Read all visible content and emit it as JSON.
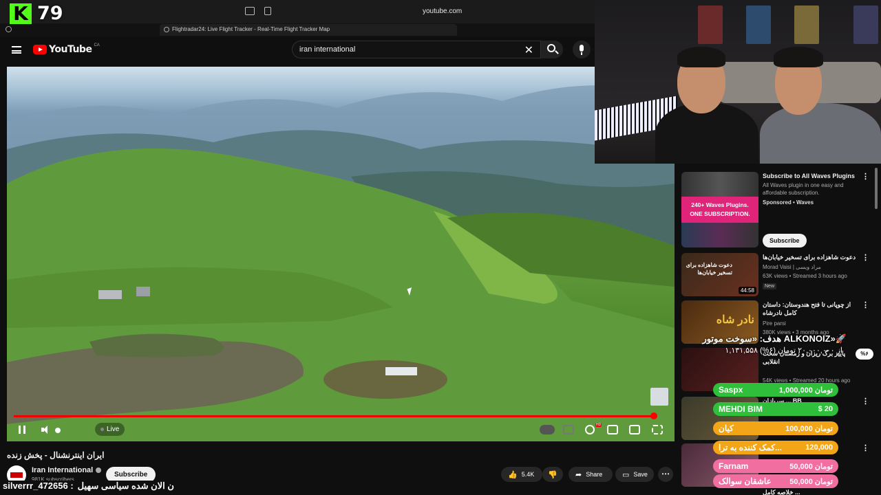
{
  "stream": {
    "viewer_count": "79",
    "platform_logo": "K"
  },
  "browser": {
    "url": "youtube.com",
    "tab_title": "Flightradar24: Live Flight Tracker - Real-Time Flight Tracker Map"
  },
  "youtube": {
    "logo_text": "YouTube",
    "region": "CA",
    "search_value": "iran international",
    "search_clear": "✕"
  },
  "player": {
    "live_label": "Live",
    "progress_fraction": 0.99
  },
  "video": {
    "title": "ایران اینترنشنال - پخش زنده",
    "channel_name": "Iran International",
    "subscribers": "981K subscribers",
    "subscribe_label": "Subscribe",
    "likes": "5.4K",
    "share_label": "Share",
    "save_label": "Save"
  },
  "chat": {
    "user": "silverrr_472656 :",
    "message": "ن الان شده سیاسی سهیل"
  },
  "sidebar": {
    "items": [
      {
        "title": "Subscribe to All Waves Plugins",
        "meta1": "All Waves plugin in one easy and affordable subscription.",
        "meta2": "Sponsored • Waves",
        "thumb_line1": "240+ Waves Plugins.",
        "thumb_line2": "ONE SUBSCRIPTION.",
        "button": "Subscribe"
      },
      {
        "title": "دعوت شاهزاده برای تسخیر خیابان‌ها",
        "meta1": "Morad Vaisi | مراد ویسی",
        "meta2": "63K views • Streamed 3 hours ago",
        "badge": "New",
        "duration": "44:58",
        "thumb_text": "دعوت شاهزاده برای تسخیر خیابان‌ها"
      },
      {
        "title": "از چوپانی تا فتح هندوستان: داستان کامل نادرشاه",
        "meta1": "Pire parsi",
        "meta2": "380K views • 3 months ago",
        "thumb_text": "نادر شاه"
      },
      {
        "title": "پاییز برگ ریزان و زمستان سخت انقلابی",
        "meta1": "",
        "meta2": "54K views • Streamed 20 hours ago"
      },
      {
        "title": "سربازان ... BB",
        "meta1": "",
        "meta2": ""
      },
      {
        "title": "برر...",
        "meta1": "",
        "meta2": ""
      },
      {
        "title": "خلاصه کامل ...",
        "meta1": "",
        "meta2": ""
      }
    ]
  },
  "overlay": {
    "goal_title": "هدف: «سوخت موتور ALKONOIZ»🚀",
    "goal_progress": "۱,۱۳۱,۵۵۸ از ۲۰,۰۰۰,۰۰۰ تومان (۶%)",
    "goal_percent": "%۶",
    "donations": [
      {
        "name": "Saspx",
        "amount": "1,000,000 تومان",
        "color": "#2fbf3a"
      },
      {
        "name": "MEHDI BIM",
        "amount": "$ 20",
        "color": "#2fbf3a"
      },
      {
        "name": "کیان",
        "amount": "100,000 تومان",
        "color": "#f2a516"
      },
      {
        "name": "کمک کننده به ترا...",
        "amount": "120,000",
        "color": "#f2a516"
      },
      {
        "name": "Farnam",
        "amount": "50,000 تومان",
        "color": "#f06fa0"
      },
      {
        "name": "عاشقان سوالک",
        "amount": "50,000 تومان",
        "color": "#f06fa0"
      }
    ]
  },
  "colors": {
    "brand": "#ff0000",
    "kick": "#53fc18",
    "background": "#0f0f0f"
  }
}
